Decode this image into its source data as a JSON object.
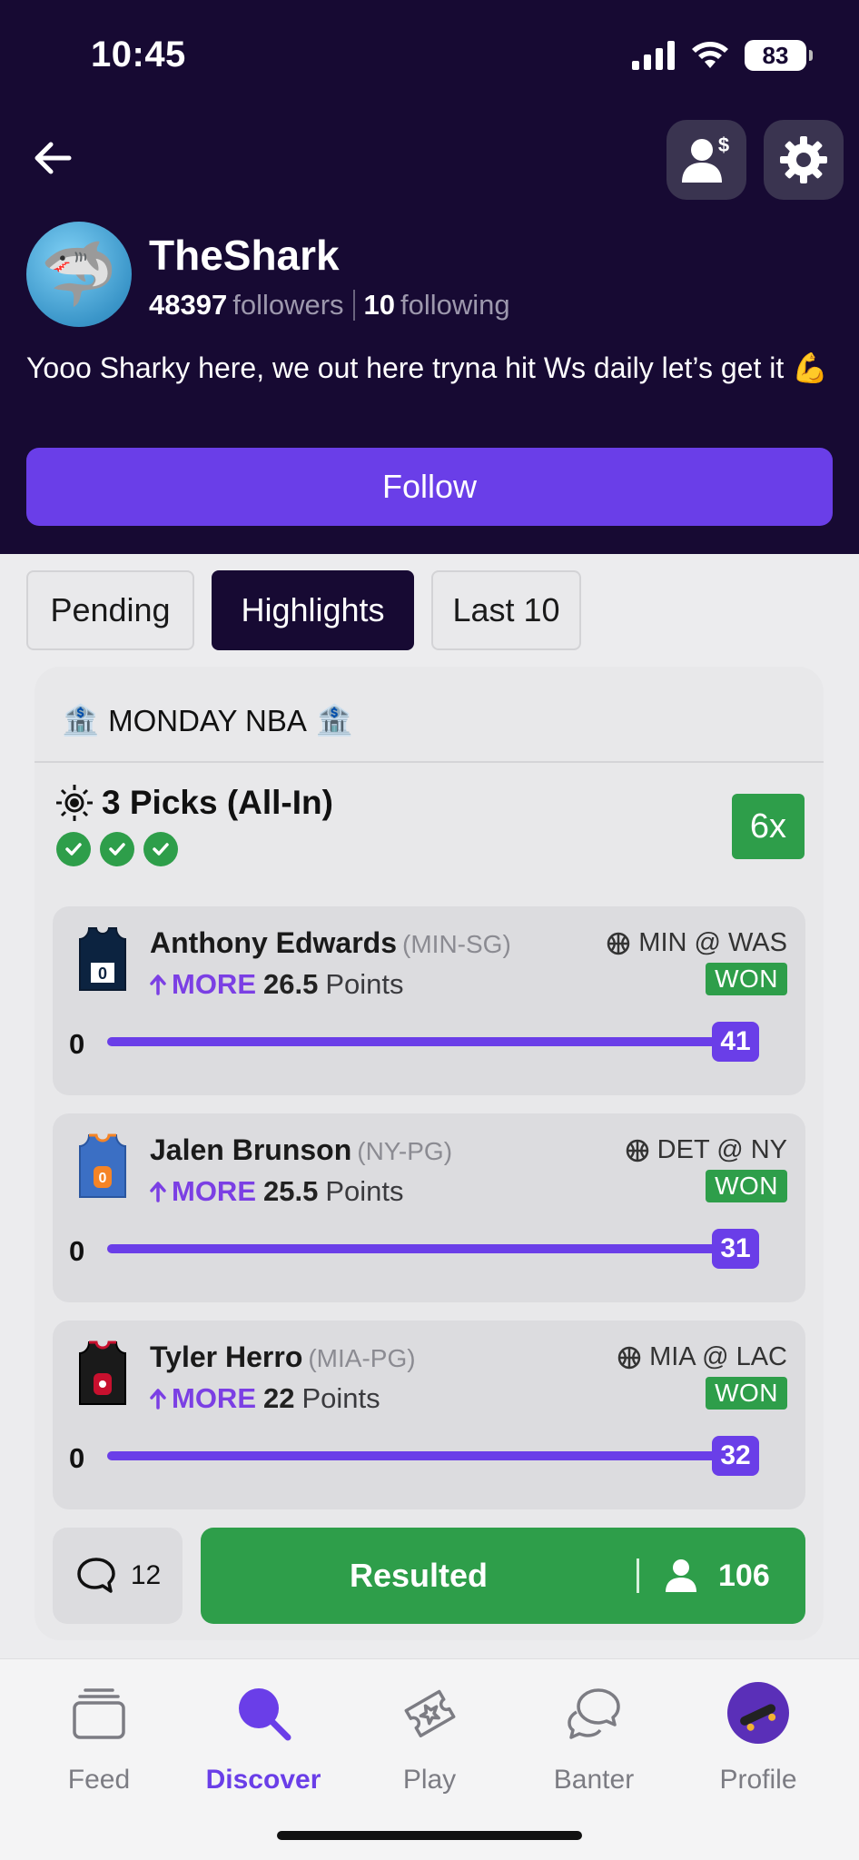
{
  "status_bar": {
    "time": "10:45",
    "battery": "83"
  },
  "profile": {
    "username": "TheShark",
    "followers_count": "48397",
    "followers_label": "followers",
    "following_count": "10",
    "following_label": "following",
    "bio": "Yooo Sharky here, we out here tryna hit Ws daily let’s get it 💪",
    "avatar_emoji": "🦈",
    "follow_label": "Follow"
  },
  "tabs": [
    {
      "label": "Pending",
      "active": false
    },
    {
      "label": "Highlights",
      "active": true
    },
    {
      "label": "Last 10",
      "active": false
    }
  ],
  "card": {
    "title_emoji": "🏦",
    "title": "MONDAY NBA",
    "picks_label": "3 Picks (All-In)",
    "multiplier": "6x",
    "legs": [
      {
        "player": "Anthony Edwards",
        "team_pos": "(MIN-SG)",
        "direction": "MORE",
        "line": "26.5",
        "stat": "Points",
        "matchup": "MIN @ WAS",
        "status": "WON",
        "min": "0",
        "result": "41",
        "progress": 1.0,
        "jersey_color": "#0c2340",
        "jersey_number": "0"
      },
      {
        "player": "Jalen Brunson",
        "team_pos": "(NY-PG)",
        "direction": "MORE",
        "line": "25.5",
        "stat": "Points",
        "matchup": "DET @ NY",
        "status": "WON",
        "min": "0",
        "result": "31",
        "progress": 1.0,
        "jersey_color": "#3b6fc4",
        "jersey_number": "0"
      },
      {
        "player": "Tyler Herro",
        "team_pos": "(MIA-PG)",
        "direction": "MORE",
        "line": "22",
        "stat": "Points",
        "matchup": "MIA @ LAC",
        "status": "WON",
        "min": "0",
        "result": "32",
        "progress": 1.0,
        "jersey_color": "#1a1a1a",
        "jersey_number": ""
      }
    ],
    "comments_count": "12",
    "resulted_label": "Resulted",
    "tails_count": "106"
  },
  "nav": [
    {
      "label": "Feed",
      "icon": "feed-icon",
      "active": false
    },
    {
      "label": "Discover",
      "icon": "search-icon",
      "active": true
    },
    {
      "label": "Play",
      "icon": "ticket-star-icon",
      "active": false
    },
    {
      "label": "Banter",
      "icon": "chat-bubbles-icon",
      "active": false
    },
    {
      "label": "Profile",
      "icon": "avatar-icon",
      "active": false
    }
  ],
  "colors": {
    "header_bg": "#170a33",
    "accent_purple": "#6a3ee8",
    "win_green": "#2e9e4a"
  }
}
